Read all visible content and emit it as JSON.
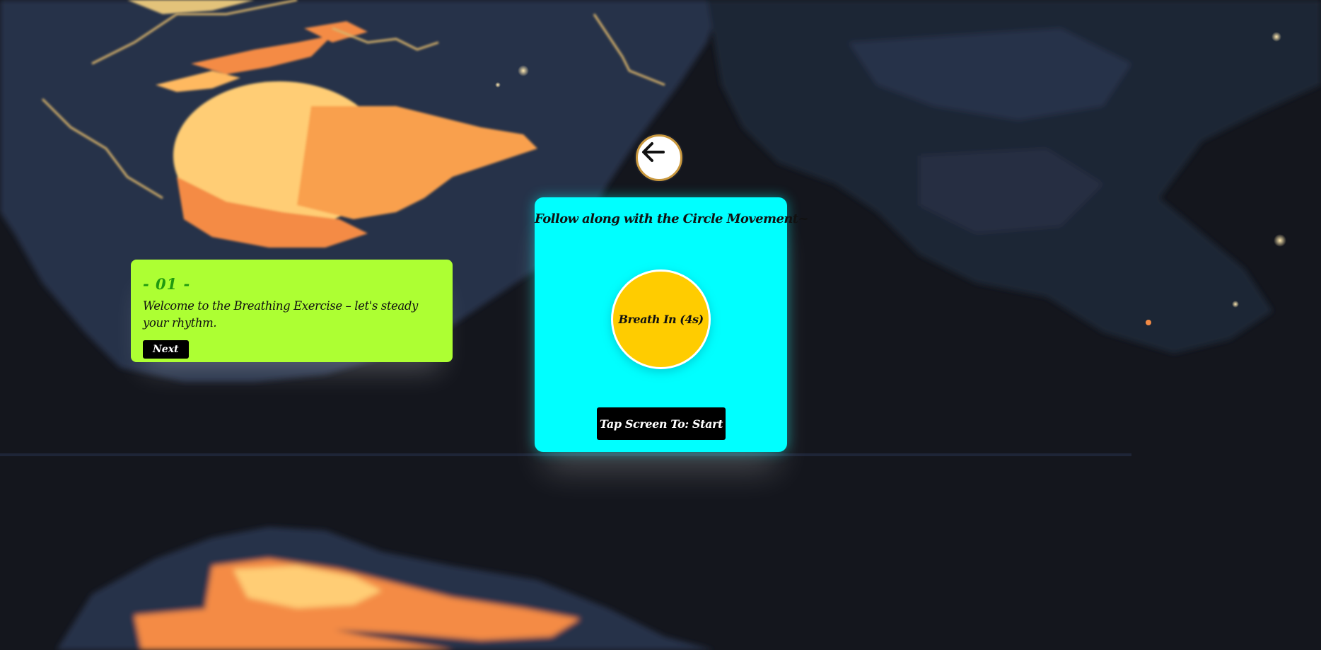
{
  "navigation": {
    "back_icon": "arrow-left-icon"
  },
  "background": {
    "description_icon": "pixel-night-sky-with-moon-and-clouds"
  },
  "tip_card": {
    "step": "- 01 -",
    "text": "Welcome to the Breathing Exercise – let's steady your rhythm.",
    "next_label": "Next",
    "color": "#adff33",
    "step_color": "#1f9a10"
  },
  "exercise_card": {
    "title": "Follow along with the Circle Movement~",
    "circle_label": "Breath In (4s)",
    "start_label": "Tap Screen To: Start",
    "card_color": "#00ffff",
    "circle_color": "#ffcc00"
  }
}
